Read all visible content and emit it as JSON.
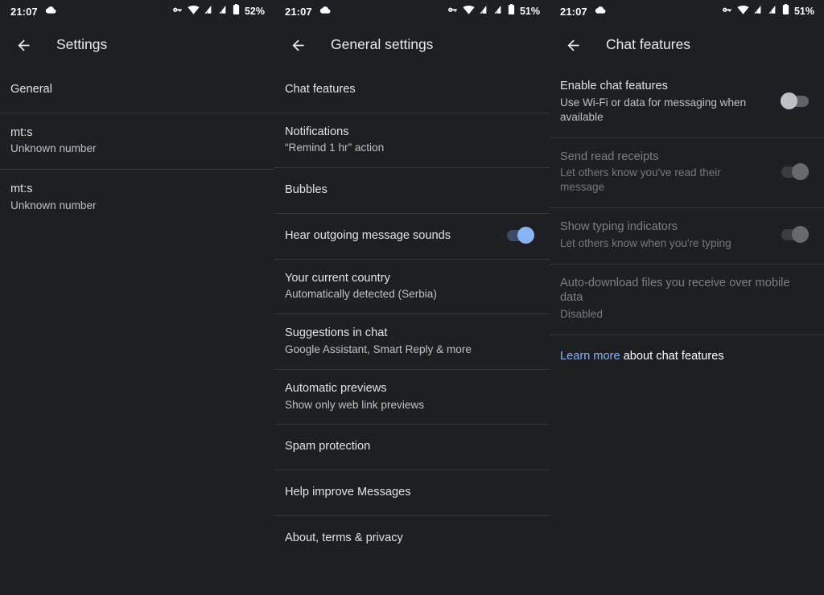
{
  "statusbar": {
    "time": "21:07",
    "icons": [
      "cloud-icon",
      "vpn-key-icon",
      "wifi-icon",
      "signal-sim1-icon",
      "signal-sim2-icon",
      "battery-icon"
    ],
    "battery_panel1": "52%",
    "battery_panel2": "51%",
    "battery_panel3": "51%"
  },
  "panel1": {
    "title": "Settings",
    "back_icon": "back-arrow-icon",
    "rows": [
      {
        "title": "General",
        "sub": ""
      },
      {
        "title": "mt:s",
        "sub": "Unknown number"
      },
      {
        "title": "mt:s",
        "sub": "Unknown number"
      }
    ]
  },
  "panel2": {
    "title": "General settings",
    "back_icon": "back-arrow-icon",
    "rows": [
      {
        "title": "Chat features",
        "sub": ""
      },
      {
        "title": "Notifications",
        "sub": "“Remind 1 hr” action"
      },
      {
        "title": "Bubbles",
        "sub": ""
      },
      {
        "title": "Hear outgoing message sounds",
        "sub": "",
        "switch": "on"
      },
      {
        "title": "Your current country",
        "sub": "Automatically detected (Serbia)"
      },
      {
        "title": "Suggestions in chat",
        "sub": "Google Assistant, Smart Reply & more"
      },
      {
        "title": "Automatic previews",
        "sub": "Show only web link previews"
      },
      {
        "title": "Spam protection",
        "sub": ""
      },
      {
        "title": "Help improve Messages",
        "sub": ""
      },
      {
        "title": "About, terms & privacy",
        "sub": ""
      }
    ]
  },
  "panel3": {
    "title": "Chat features",
    "back_icon": "back-arrow-icon",
    "rows": [
      {
        "title": "Enable chat features",
        "sub": "Use Wi-Fi or data for messaging when available",
        "switch": "off",
        "disabled": false
      },
      {
        "title": "Send read receipts",
        "sub": "Let others know you've read their message",
        "switch": "on-disabled",
        "disabled": true
      },
      {
        "title": "Show typing indicators",
        "sub": "Let others know when you're typing",
        "switch": "on-disabled",
        "disabled": true
      },
      {
        "title": "Auto-download files you receive over mobile data",
        "sub": "Disabled",
        "disabled": true
      }
    ],
    "learn_more_link": "Learn more",
    "learn_more_rest": " about chat features"
  },
  "colors": {
    "background": "#1e1f22",
    "divider": "#35373b",
    "accent_blue": "#8ab4f8",
    "text_primary": "#e3e3e3",
    "text_secondary": "#bdc1c6",
    "text_disabled": "#7c7f83"
  }
}
